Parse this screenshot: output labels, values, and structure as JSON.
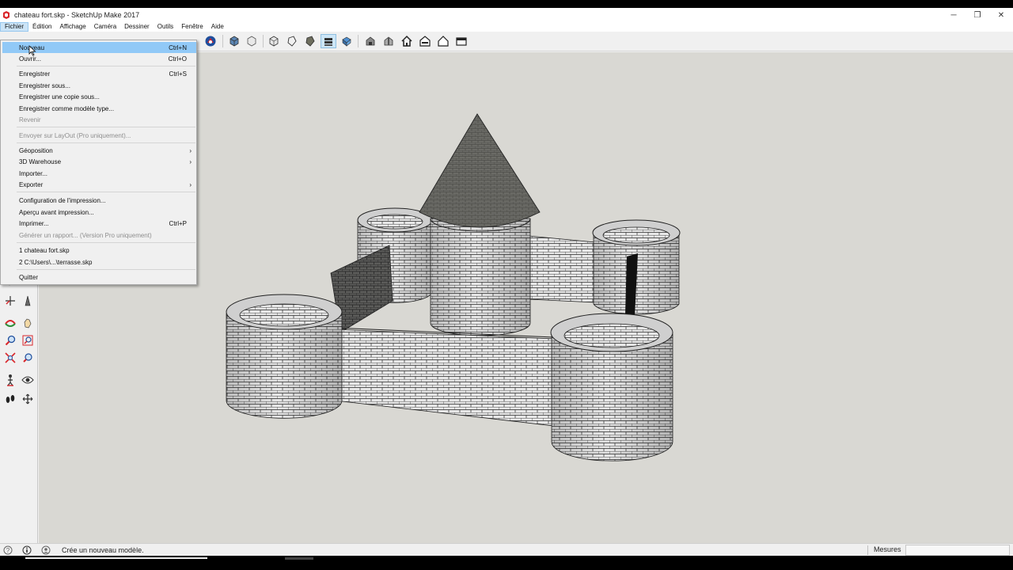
{
  "window": {
    "title": "chateau fort.skp - SketchUp Make 2017",
    "controls": {
      "minimize": "─",
      "restore": "❐",
      "close": "✕"
    }
  },
  "menubar": {
    "items": [
      {
        "label": "Fichier",
        "active": true
      },
      {
        "label": "Édition"
      },
      {
        "label": "Affichage"
      },
      {
        "label": "Caméra"
      },
      {
        "label": "Dessiner"
      },
      {
        "label": "Outils"
      },
      {
        "label": "Fenêtre"
      },
      {
        "label": "Aide"
      }
    ]
  },
  "file_menu": {
    "items": [
      {
        "label": "Nouveau",
        "shortcut": "Ctrl+N"
      },
      {
        "label": "Ouvrir...",
        "shortcut": "Ctrl+O"
      },
      {
        "label": "Enregistrer",
        "shortcut": "Ctrl+S"
      },
      {
        "label": "Enregistrer sous..."
      },
      {
        "label": "Enregistrer une copie sous..."
      },
      {
        "label": "Enregistrer comme modèle type..."
      },
      {
        "label": "Revenir"
      },
      {
        "label": "Envoyer sur LayOut (Pro uniquement)..."
      },
      {
        "label": "Géoposition"
      },
      {
        "label": "3D Warehouse"
      },
      {
        "label": "Importer..."
      },
      {
        "label": "Exporter"
      },
      {
        "label": "Configuration de l'impression..."
      },
      {
        "label": "Aperçu avant impression..."
      },
      {
        "label": "Imprimer...",
        "shortcut": "Ctrl+P"
      },
      {
        "label": "Générer un rapport... (Version Pro uniquement)"
      },
      {
        "label": "1 chateau fort.skp"
      },
      {
        "label": "2 C:\\Users\\...\\terrasse.skp"
      },
      {
        "label": "Quitter"
      }
    ]
  },
  "toolbar": {
    "icons": [
      "warehouse-icon",
      "iso-view-icon",
      "top-view-icon",
      "xray-icon",
      "wireframe-icon",
      "hidden-line-icon",
      "shaded-icon",
      "shaded-textures-icon",
      "monochrome-icon",
      "front-view-icon",
      "right-view-icon",
      "back-view-icon",
      "left-view-icon",
      "house-icon",
      "bottom-view-icon"
    ]
  },
  "status": {
    "message": "Crée un nouveau modèle.",
    "measures_label": "Mesures",
    "measures_value": ""
  }
}
